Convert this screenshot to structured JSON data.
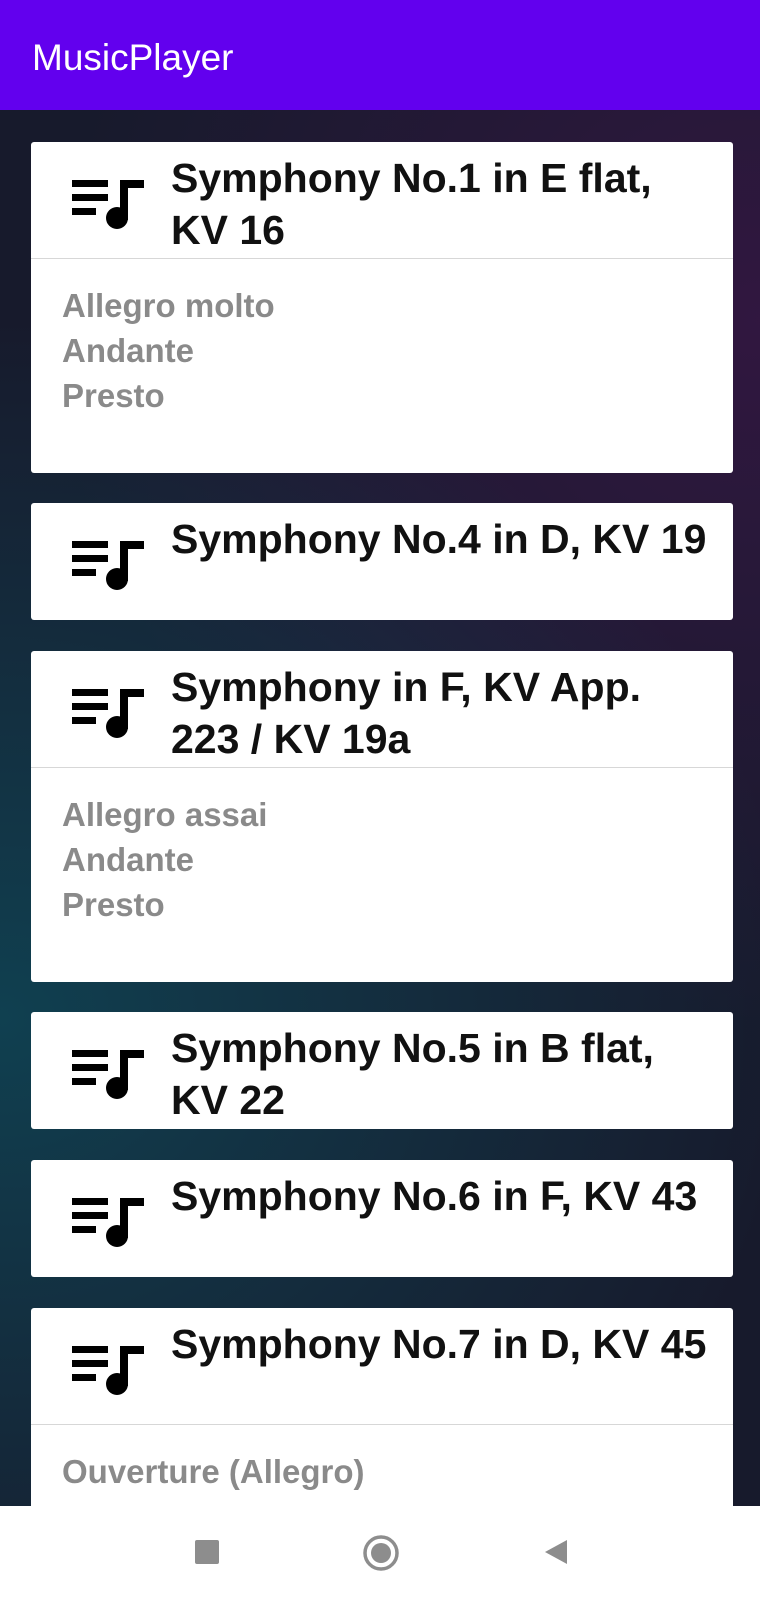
{
  "app_bar": {
    "title": "MusicPlayer"
  },
  "symphonies": [
    {
      "title": "Symphony No.1 in E flat, KV 16",
      "movements": [
        "Allegro molto",
        "Andante",
        "Presto"
      ]
    },
    {
      "title": "Symphony No.4 in D, KV 19",
      "movements": []
    },
    {
      "title": "Symphony in F, KV App. 223 / KV 19a",
      "movements": [
        "Allegro assai",
        "Andante",
        "Presto"
      ]
    },
    {
      "title": "Symphony No.5 in B flat, KV 22",
      "movements": []
    },
    {
      "title": "Symphony No.6 in F, KV 43",
      "movements": []
    },
    {
      "title": "Symphony No.7 in D, KV 45",
      "movements": [
        "Ouverture (Allegro)"
      ]
    }
  ],
  "icons": {
    "card": "playlist-music-icon",
    "nav": [
      "recents-square-icon",
      "home-circle-icon",
      "back-triangle-icon"
    ]
  },
  "colors": {
    "app_bar": "#6200ee",
    "movement_text": "#8a8a8a"
  }
}
